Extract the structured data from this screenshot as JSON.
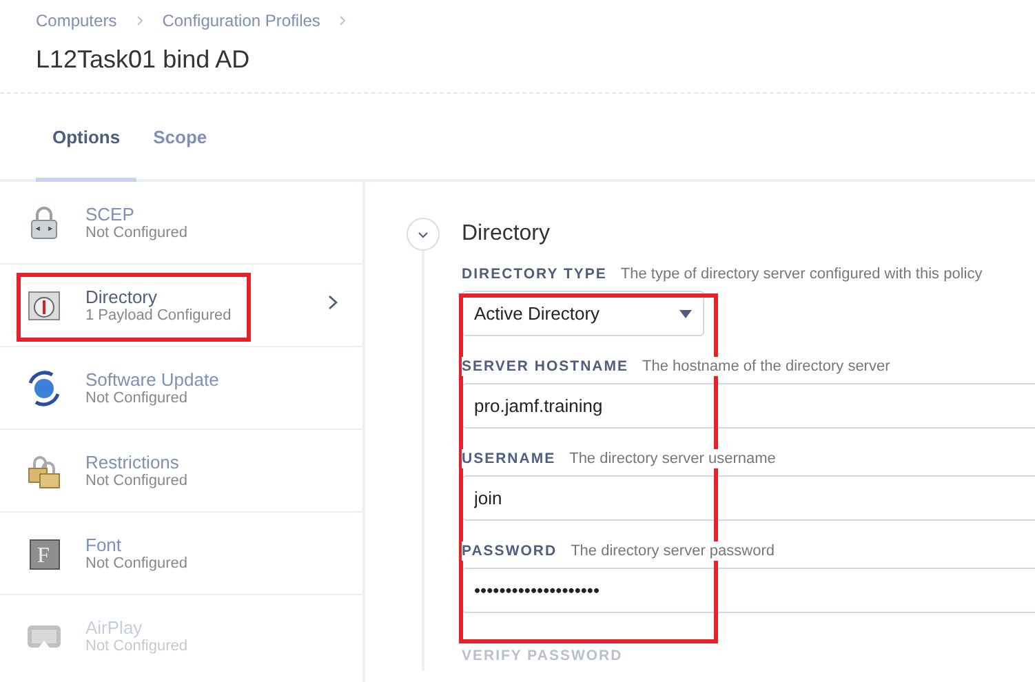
{
  "breadcrumbs": [
    "Computers",
    "Configuration Profiles"
  ],
  "title": "L12Task01 bind AD",
  "tabs": [
    {
      "label": "Options",
      "selected": true
    },
    {
      "label": "Scope",
      "selected": false
    }
  ],
  "sidebar": {
    "items": [
      {
        "kind": "lock",
        "name": "SCEP",
        "status": "Not Configured",
        "selected": false,
        "annotated": false,
        "faded": false
      },
      {
        "kind": "directory",
        "name": "Directory",
        "status": "1 Payload Configured",
        "selected": true,
        "annotated": true,
        "faded": false
      },
      {
        "kind": "globe",
        "name": "Software Update",
        "status": "Not Configured",
        "selected": false,
        "annotated": false,
        "faded": false
      },
      {
        "kind": "padlocks",
        "name": "Restrictions",
        "status": "Not Configured",
        "selected": false,
        "annotated": false,
        "faded": false
      },
      {
        "kind": "font",
        "icon_text": "F",
        "name": "Font",
        "status": "Not Configured",
        "selected": false,
        "annotated": false,
        "faded": false
      },
      {
        "kind": "display",
        "name": "AirPlay",
        "status": "Not Configured",
        "selected": false,
        "annotated": false,
        "faded": true
      }
    ]
  },
  "section": {
    "title": "Directory",
    "expanded": true,
    "annotated": true,
    "fields": [
      {
        "kind": "select",
        "label": "DIRECTORY TYPE",
        "hint": "The type of directory server configured with this policy",
        "value": "Active Directory"
      },
      {
        "kind": "text",
        "label": "SERVER HOSTNAME",
        "hint": "The hostname of the directory server",
        "value": "pro.jamf.training"
      },
      {
        "kind": "text",
        "label": "USERNAME",
        "hint": "The directory server username",
        "value": "join"
      },
      {
        "kind": "password",
        "label": "PASSWORD",
        "hint": "The directory server password",
        "value": "••••••••••••••••••••"
      }
    ],
    "next_label": "VERIFY PASSWORD"
  }
}
